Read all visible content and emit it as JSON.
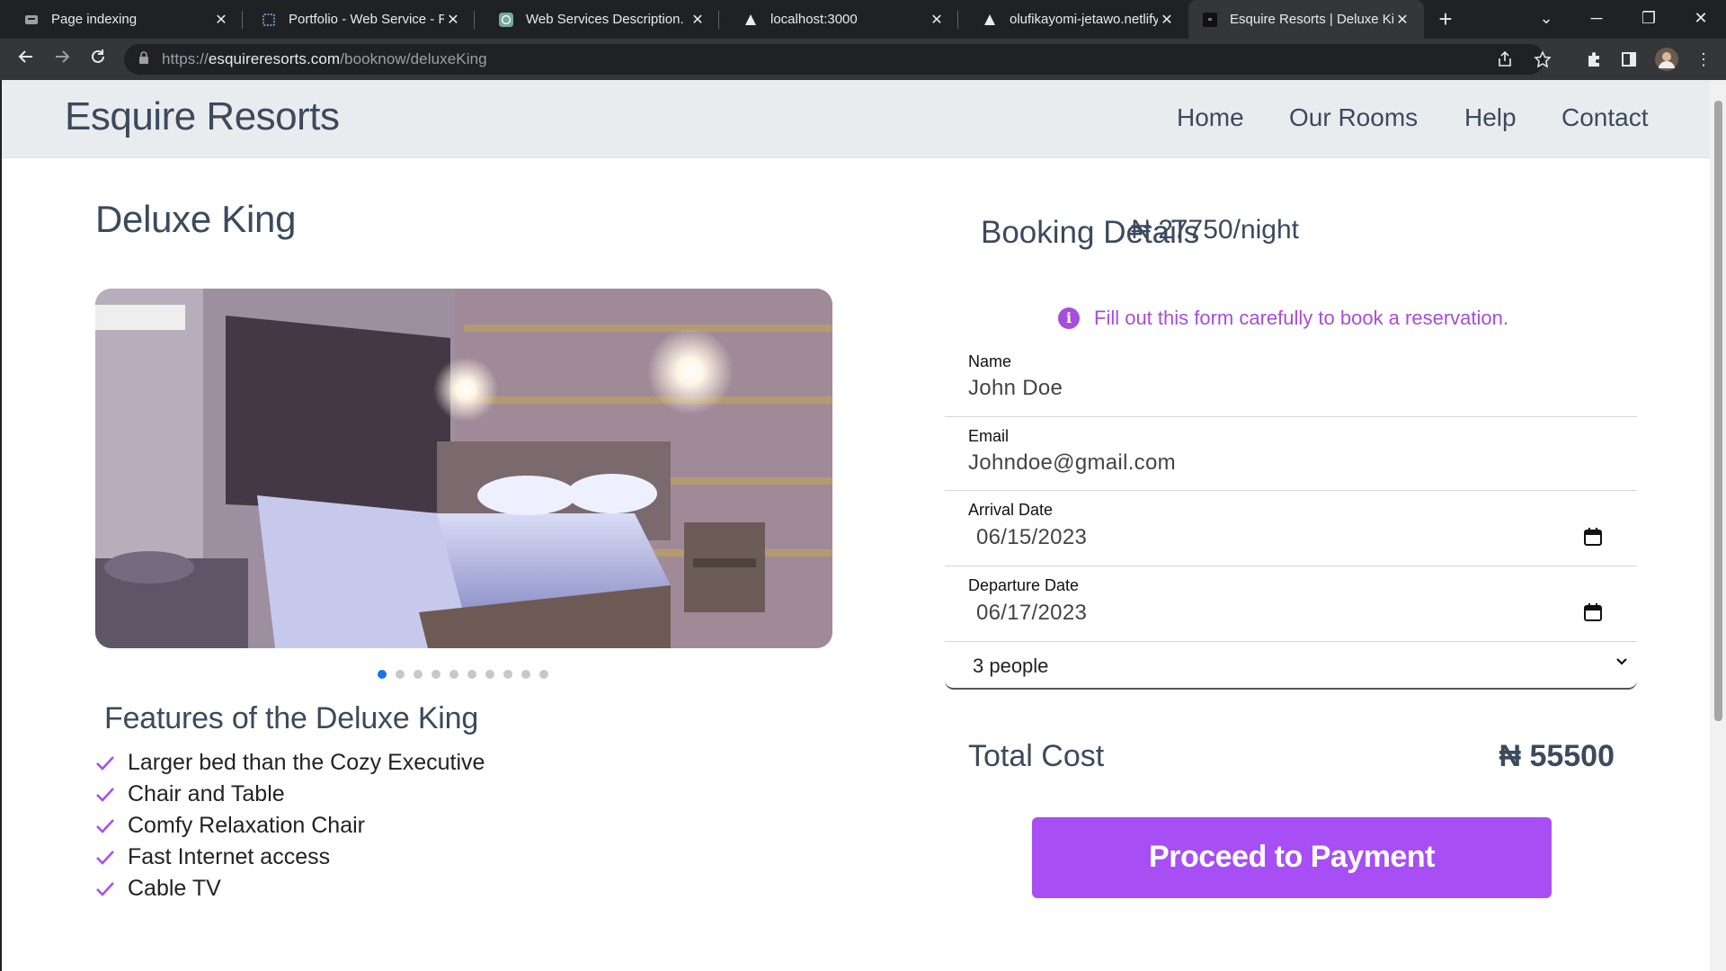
{
  "browser": {
    "tabs": [
      {
        "title": "Page indexing",
        "active": false
      },
      {
        "title": "Portfolio - Web Service - Re",
        "active": false
      },
      {
        "title": "Web Services Description.",
        "active": false
      },
      {
        "title": "localhost:3000",
        "active": false
      },
      {
        "title": "olufikayomi-jetawo.netlify.a",
        "active": false
      },
      {
        "title": "Esquire Resorts | Deluxe Kin",
        "active": true
      }
    ],
    "url_scheme": "https://",
    "url_host": "esquireresorts.com",
    "url_path": "/booknow/deluxeKing"
  },
  "header": {
    "brand": "Esquire Resorts",
    "nav": [
      "Home",
      "Our Rooms",
      "Help",
      "Contact"
    ]
  },
  "room": {
    "title": "Deluxe King",
    "carousel_count": 10,
    "carousel_active_index": 0,
    "features_title": "Features of the Deluxe King",
    "features": [
      "Larger bed than the Cozy Executive",
      "Chair and Table",
      "Comfy Relaxation Chair",
      "Fast Internet access",
      "Cable TV"
    ]
  },
  "booking": {
    "title": "Booking Details",
    "price": "₦ 27750/night",
    "notice": "Fill out this form carefully to book a reservation.",
    "name_label": "Name",
    "name_value": "John Doe",
    "email_label": "Email",
    "email_value": "Johndoe@gmail.com",
    "arrival_label": "Arrival Date",
    "arrival_value": "06/15/2023",
    "departure_label": "Departure Date",
    "departure_value": "06/17/2023",
    "guests_value": "3 people",
    "total_label": "Total Cost",
    "total_value": "₦ 55500",
    "pay_button": "Proceed to Payment"
  },
  "colors": {
    "accent": "#a74ff5",
    "notice": "#a64ddb",
    "heading": "#3b4a5c",
    "header_bg": "#e9ecef"
  }
}
